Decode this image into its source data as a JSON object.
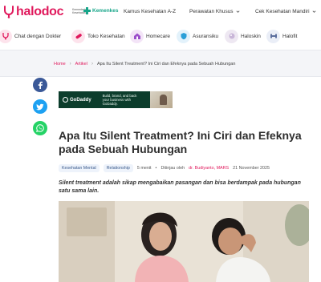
{
  "brand": {
    "name": "halodoc",
    "color": "#e0195c"
  },
  "partner": {
    "small_text": "Kementerian Kesehatan",
    "label": "Kemenkes"
  },
  "topnav": [
    {
      "label": "Kamus Kesehatan A-Z"
    },
    {
      "label": "Perawatan Khusus"
    },
    {
      "label": "Cek Kesehatan Mandiri"
    }
  ],
  "subnav": [
    {
      "label": "Chat dengan Dokter",
      "icon": "stethoscope-icon"
    },
    {
      "label": "Toko Kesehatan",
      "icon": "pill-icon"
    },
    {
      "label": "Homecare",
      "icon": "homecare-icon"
    },
    {
      "label": "Asuransiku",
      "icon": "shield-icon"
    },
    {
      "label": "Haloskin",
      "icon": "haloskin-icon"
    },
    {
      "label": "Halofit",
      "icon": "halofit-icon"
    }
  ],
  "breadcrumb": {
    "home": "Home",
    "section": "Artikel",
    "current": "Apa Itu Silent Treatment? Ini Ciri dan Efeknya pada Sebuah Hubungan"
  },
  "share": [
    {
      "name": "facebook-icon",
      "glyph": "f",
      "color": "#3b5998"
    },
    {
      "name": "twitter-icon",
      "glyph": "",
      "color": "#1da1f2"
    },
    {
      "name": "whatsapp-icon",
      "glyph": "",
      "color": "#25d366"
    }
  ],
  "ad": {
    "logo": "GoDaddy",
    "copy": "Build, brand, and back your business with GoDaddy."
  },
  "article": {
    "title": "Apa Itu Silent Treatment? Ini Ciri dan Efeknya pada Sebuah Hubungan",
    "tags": [
      "Kesehatan Mental",
      "Relationship"
    ],
    "read_time": "5 menit",
    "reviewed_prefix": "Ditinjau oleh",
    "reviewer": "dr. Budiyanto, MARS",
    "date": "21 November 2025",
    "lead": "Silent treatment adalah sikap mengabaikan pasangan dan bisa berdampak pada hubungan satu sama lain."
  }
}
